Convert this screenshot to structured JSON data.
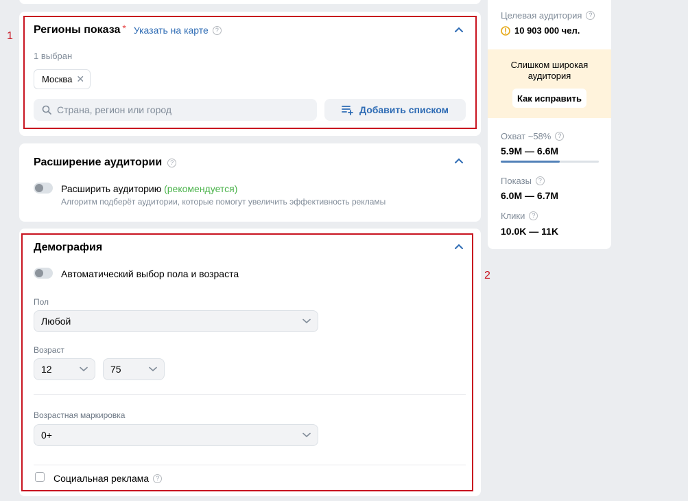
{
  "regions": {
    "title": "Регионы показа",
    "required_mark": "*",
    "map_link": "Указать на карте",
    "selected_count": "1 выбран",
    "chips": [
      {
        "label": "Москва"
      }
    ],
    "search_placeholder": "Страна, регион или город",
    "add_list_label": "Добавить списком"
  },
  "expansion": {
    "title": "Расширение аудитории",
    "toggle_label": "Расширить аудиторию",
    "recommended": "(рекомендуется)",
    "description": "Алгоритм подберёт аудитории, которые помогут увеличить эффективность рекламы"
  },
  "demography": {
    "title": "Демография",
    "auto_label": "Автоматический выбор пола и возраста",
    "gender_label": "Пол",
    "gender_value": "Любой",
    "age_label": "Возраст",
    "age_from": "12",
    "age_to": "75",
    "marking_label": "Возрастная маркировка",
    "marking_value": "0+",
    "social_label": "Социальная реклама"
  },
  "sidebar": {
    "audience_label": "Целевая аудитория",
    "audience_value": "10 903 000 чел.",
    "warning_text": "Слишком широкая аудитория",
    "fix_button": "Как исправить",
    "reach_label": "Охват ~58%",
    "reach_value": "5.9M — 6.6M",
    "reach_progress": 0.6,
    "impressions_label": "Показы",
    "impressions_value": "6.0M — 6.7M",
    "clicks_label": "Клики",
    "clicks_value": "10.0K — 11K"
  },
  "annotations": {
    "box1": "1",
    "box2": "2"
  },
  "colors": {
    "accent": "#2d6bb4",
    "annotation_red": "#c8131f",
    "recommended_green": "#4bb34b",
    "warning_icon": "#e6a817",
    "warning_bg": "#fff3dc"
  }
}
